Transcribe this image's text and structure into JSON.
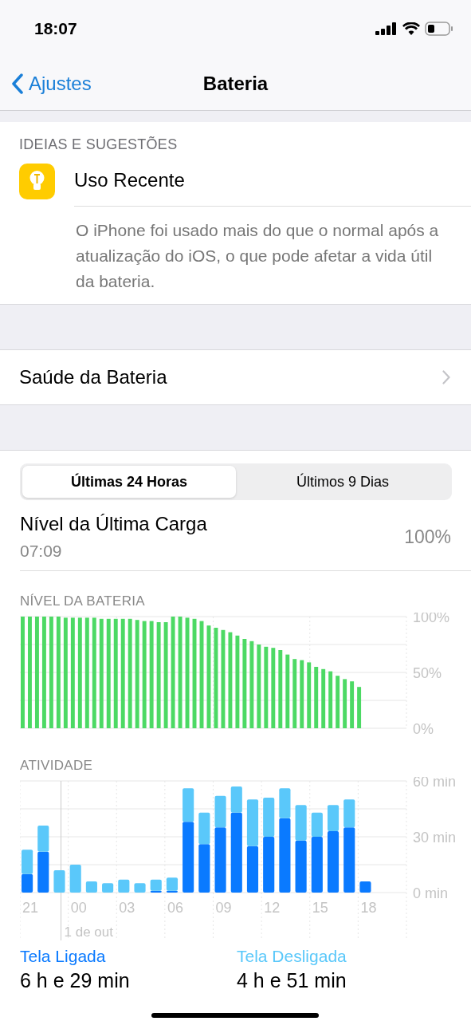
{
  "status_bar": {
    "time": "18:07"
  },
  "nav": {
    "back": "Ajustes",
    "title": "Bateria"
  },
  "suggestions": {
    "header": "IDEIAS E SUGESTÕES",
    "title": "Uso Recente",
    "text": "O iPhone foi usado mais do que o normal após a atualização do iOS, o que pode afetar a vida útil da bateria."
  },
  "health_row": {
    "label": "Saúde da Bateria"
  },
  "segments": [
    {
      "label": "Últimas 24 Horas",
      "selected": true
    },
    {
      "label": "Últimos 9 Dias",
      "selected": false
    }
  ],
  "last_charge": {
    "label": "Nível da Última Carga",
    "time": "07:09",
    "value": "100%"
  },
  "battery_level": {
    "header": "NÍVEL DA BATERIA",
    "chart_data": {
      "type": "bar",
      "color": "#4cd964",
      "values": [
        100,
        100,
        100,
        100,
        100,
        100,
        99,
        99,
        99,
        99,
        99,
        98,
        98,
        98,
        98,
        98,
        97,
        96,
        96,
        95,
        95,
        100,
        100,
        99,
        98,
        96,
        92,
        90,
        88,
        86,
        83,
        80,
        78,
        75,
        73,
        72,
        70,
        66,
        62,
        61,
        59,
        55,
        53,
        51,
        47,
        44,
        42,
        37,
        null,
        null,
        null,
        null,
        null,
        null
      ],
      "ylim": [
        0,
        100
      ],
      "yticks": [
        {
          "value": 0,
          "label": "0%"
        },
        {
          "value": 50,
          "label": "50%"
        },
        {
          "value": 100,
          "label": "100%"
        }
      ]
    }
  },
  "activity": {
    "header": "ATIVIDADE",
    "chart_data": {
      "type": "bar",
      "stacked": true,
      "categories": [
        "21",
        null,
        null,
        "00",
        null,
        null,
        "03",
        null,
        null,
        "06",
        null,
        null,
        "09",
        null,
        null,
        "12",
        null,
        null,
        "15",
        null,
        null,
        "18",
        null,
        null
      ],
      "series": [
        {
          "name": "Tela Ligada",
          "color": "#0a7aff",
          "values": [
            10,
            22,
            0,
            0,
            0,
            0,
            0,
            0,
            1,
            1,
            38,
            26,
            35,
            43,
            25,
            30,
            40,
            28,
            30,
            33,
            35,
            6,
            null,
            null
          ]
        },
        {
          "name": "Tela Desligada",
          "color": "#5ac8fa",
          "values": [
            13,
            14,
            12,
            15,
            6,
            5,
            7,
            5,
            6,
            7,
            18,
            17,
            17,
            14,
            25,
            21,
            16,
            19,
            13,
            14,
            15,
            0,
            null,
            null
          ]
        }
      ],
      "ylim": [
        0,
        60
      ],
      "yticks": [
        {
          "value": 0,
          "label": "0 min"
        },
        {
          "value": 30,
          "label": "30 min"
        },
        {
          "value": 60,
          "label": "60 min"
        }
      ]
    },
    "date_label": "1 de out"
  },
  "summary": [
    {
      "value": "6 h e 29 min"
    },
    {
      "value": "4 h e 51 min"
    }
  ]
}
